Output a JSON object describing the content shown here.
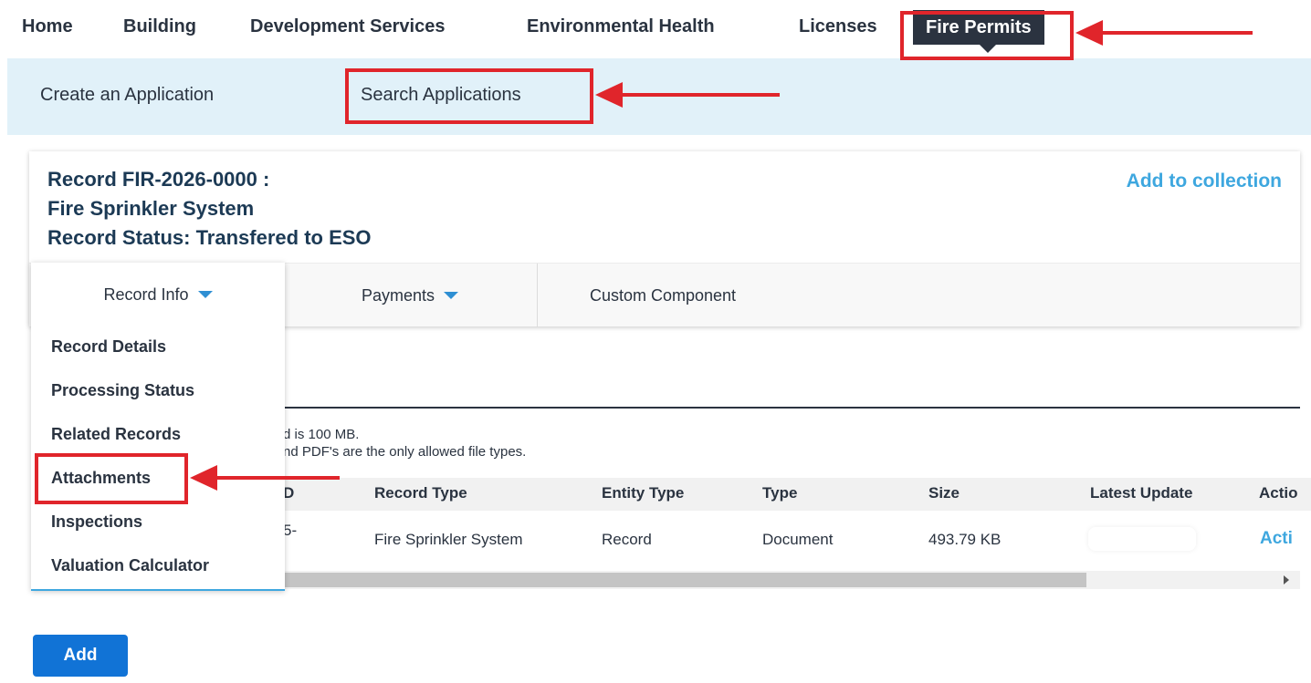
{
  "top_nav": {
    "items": [
      "Home",
      "Building",
      "Development Services",
      "Environmental Health",
      "Licenses",
      "Fire Permits"
    ],
    "active": "Fire Permits"
  },
  "sub_nav": {
    "items": [
      "Create an Application",
      "Search Applications"
    ]
  },
  "record": {
    "line1": "Record FIR-2026-0000  :",
    "line2": "Fire Sprinkler System",
    "line3": "Record Status: Transfered to ESO",
    "add_to_collection": "Add to collection"
  },
  "tabs": {
    "record_info": "Record Info",
    "payments": "Payments",
    "custom_component": "Custom Component"
  },
  "dropdown": {
    "items": [
      "Record Details",
      "Processing Status",
      "Related Records",
      "Attachments",
      "Inspections",
      "Valuation Calculator"
    ]
  },
  "attachments": {
    "info_line1": "d is 100 MB.",
    "info_line2": "nd PDF's are the only allowed file types.",
    "columns": [
      "D",
      "Record Type",
      "Entity Type",
      "Type",
      "Size",
      "Latest Update",
      "Actio"
    ],
    "row": {
      "id_fragment": "5-",
      "record_type": "Fire Sprinkler System",
      "entity_type": "Record",
      "type": "Document",
      "size": "493.79 KB",
      "action": "Acti"
    },
    "add_button": "Add"
  },
  "colors": {
    "highlight": "#e0252b",
    "accent_blue": "#3ea7df",
    "button_blue": "#1173d6",
    "subnav_bg": "#e1f1f9",
    "active_tab_bg": "#2b3340"
  }
}
